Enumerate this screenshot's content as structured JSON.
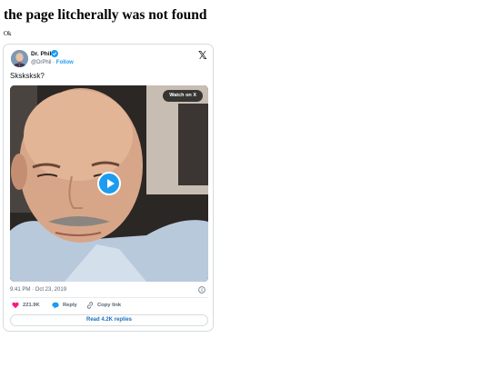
{
  "page": {
    "heading": "the page litcherally was not found",
    "subtext": "Ok"
  },
  "tweet": {
    "author_name": "Dr. Phil",
    "author_handle": "@DrPhil",
    "separator": "·",
    "follow_label": "Follow",
    "logo": "𝕏",
    "text": "Sksksksk?",
    "watch_label": "Watch on X",
    "timestamp": "9:41 PM · Oct 23, 2019",
    "likes_count": "221.9K",
    "reply_label": "Reply",
    "copy_link_label": "Copy link",
    "read_replies_label": "Read 4.2K replies"
  },
  "icons": [
    "x-logo-icon",
    "verified-badge-icon",
    "play-icon",
    "info-icon",
    "heart-icon",
    "reply-bubble-icon",
    "link-icon"
  ],
  "colors": {
    "accent": "#1d9bf0",
    "heart": "#f91880",
    "muted_text": "#536471",
    "border": "#d5dbdf"
  }
}
